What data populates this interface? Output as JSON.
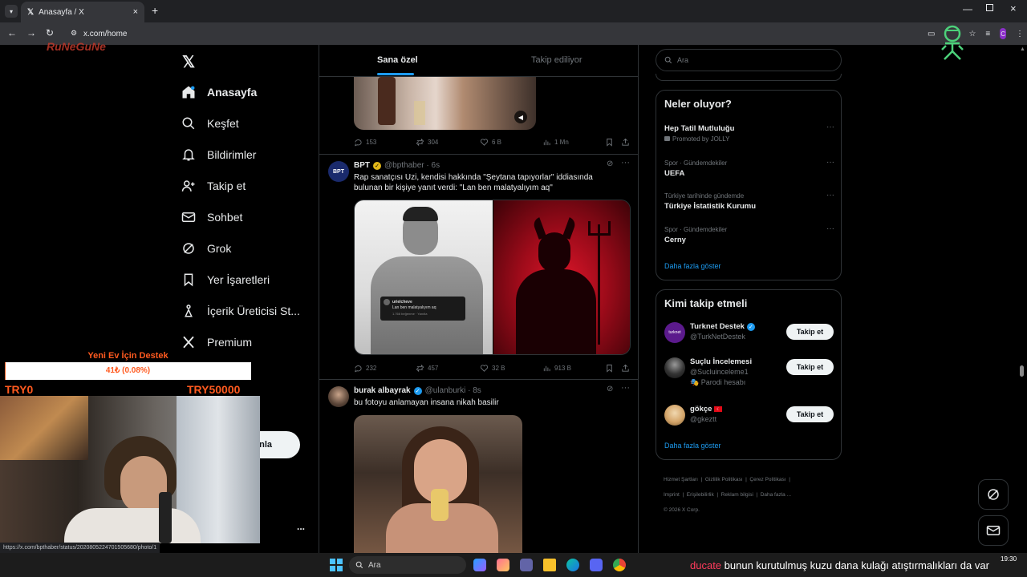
{
  "browser": {
    "tab_title": "Anasayfa / X",
    "url": "x.com/home",
    "status_url": "https://x.com/bpthaber/status/2020805224701505680/photo/1"
  },
  "nav": {
    "items": [
      {
        "label": "Anasayfa",
        "icon": "home-icon"
      },
      {
        "label": "Keşfet",
        "icon": "search-icon"
      },
      {
        "label": "Bildirimler",
        "icon": "bell-icon"
      },
      {
        "label": "Takip et",
        "icon": "add-user-icon"
      },
      {
        "label": "Sohbet",
        "icon": "mail-icon"
      },
      {
        "label": "Grok",
        "icon": "grok-icon"
      },
      {
        "label": "Yer İşaretleri",
        "icon": "bookmark-icon"
      },
      {
        "label": "İçerik Üreticisi St...",
        "icon": "creator-icon"
      },
      {
        "label": "Premium",
        "icon": "x-icon"
      }
    ],
    "post_button_partial": "nla",
    "more": "..."
  },
  "feed": {
    "tabs": [
      "Sana özel",
      "Takip ediliyor"
    ],
    "prev_stats": {
      "replies": "153",
      "reposts": "304",
      "likes": "6 B",
      "views": "1 Mn"
    },
    "tweets": [
      {
        "avatar_text": "BPT",
        "name": "BPT",
        "handle": "@bpthaber · 6s",
        "text": "Rap sanatçısı Uzi, kendisi hakkında \"Şeytana tapıyorlar\" iddiasında bulunan bir kişiye yanıt verdi: \"Lan ben malatyalıyım aq\"",
        "embed_user": "urielcheve",
        "embed_text": "Lan ben malatyalıyım aq",
        "embed_meta": "1.766 beğenme · Yanıtla",
        "stats": {
          "replies": "232",
          "reposts": "457",
          "likes": "32 B",
          "views": "913 B"
        }
      },
      {
        "name": "burak albayrak",
        "handle": "@ulanburki · 8s",
        "text": "bu fotoyu anlamayan insana nikah basilir"
      }
    ]
  },
  "search": {
    "placeholder": "Ara"
  },
  "trends": {
    "title": "Neler oluyor?",
    "items": [
      {
        "meta": "",
        "name": "Hep Tatil Mutluluğu",
        "promo": "Promoted by JOLLY"
      },
      {
        "meta": "Spor · Gündemdekiler",
        "name": "UEFA"
      },
      {
        "meta": "Türkiye tarihinde gündemde",
        "name": "Türkiye İstatistik Kurumu"
      },
      {
        "meta": "Spor · Gündemdekiler",
        "name": "Cerny"
      }
    ],
    "more": "Daha fazla göster"
  },
  "follow": {
    "title": "Kimi takip etmeli",
    "items": [
      {
        "name": "Turknet Destek",
        "handle": "@TurkNetDestek",
        "sub": "",
        "avatar_text": "turknet"
      },
      {
        "name": "Suçlu İncelemesi",
        "handle": "@Sucluinceleme1",
        "sub": "Parodi hesabı",
        "avatar_text": ""
      },
      {
        "name": "gökçe",
        "handle": "@gkeztt",
        "sub": "",
        "avatar_text": ""
      }
    ],
    "button": "Takip et",
    "more": "Daha fazla göster"
  },
  "footer": {
    "links": [
      "Hizmet Şartları",
      "Gizlilik Politikası",
      "Çerez Politikası",
      "Imprint",
      "Erişilebilirlik",
      "Reklam bilgisi",
      "Daha fazla ..."
    ],
    "copyright": "© 2026 X Corp."
  },
  "overlay": {
    "brand": "RuNeGuNe",
    "donation_title": "Yeni Ev İçin Destek",
    "donation_value": "41₺ (0.08%)",
    "donation_progress": 0.0008,
    "min": "TRY0",
    "max": "TRY50000"
  },
  "taskbar": {
    "search": "Ara",
    "ticker_highlight": "ducate",
    "ticker": "bunun kurutulmuş kuzu dana kulağı atıştırmalıkları da var",
    "time": "19:30"
  },
  "colors": {
    "accent": "#1d9bf0",
    "link": "#1d9bf0",
    "donation_orange": "#ff5a1f",
    "verified": "#1d9bf0",
    "gold_verified": "#e2b719"
  }
}
